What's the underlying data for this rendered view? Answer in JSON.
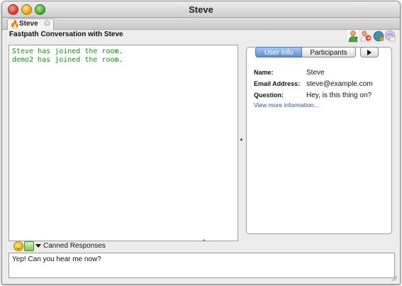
{
  "window": {
    "title": "Steve"
  },
  "tabs": [
    {
      "label": "Steve",
      "icon": "flame-icon"
    }
  ],
  "header": {
    "title": "Fastpath Conversation with Steve",
    "toolbar_icons": [
      "user-add-icon",
      "user-transfer-icon",
      "globe-icon",
      "invite-icon"
    ]
  },
  "chat": {
    "lines": [
      "Steve has joined the room.",
      "demo2 has joined the room."
    ]
  },
  "info_panel": {
    "segments": [
      "User Info",
      "Participants"
    ],
    "selected": "User Info",
    "fields": [
      {
        "label": "Name:",
        "value": "Steve"
      },
      {
        "label": "Email Address:",
        "value": "steve@example.com"
      },
      {
        "label": "Question:",
        "value": "Hey, is this thing on?"
      }
    ],
    "more_link": "View more information..."
  },
  "compose": {
    "canned_label": "Canned Responses",
    "text": "Yep! Can you hear me now?"
  },
  "colors": {
    "chat_text": "#1e8a1e",
    "link": "#2a4f9a",
    "selected_segment": "#5c8fd6"
  }
}
